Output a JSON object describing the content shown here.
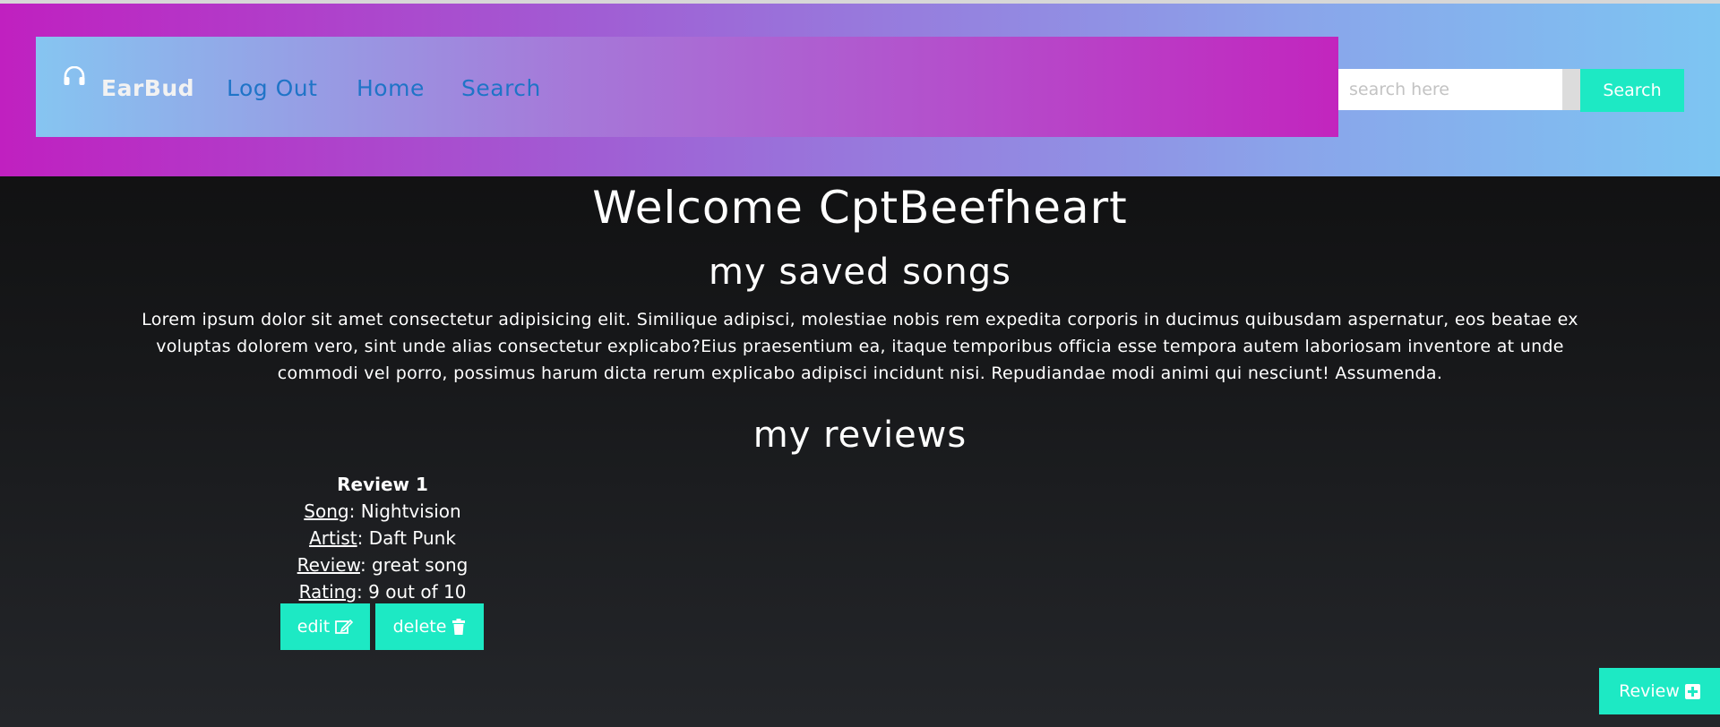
{
  "nav": {
    "brand": "EarBud",
    "links": [
      "Log Out",
      "Home",
      "Search"
    ],
    "brand_icon": "headphones-icon"
  },
  "search": {
    "placeholder": "search here",
    "value": "",
    "button_label": "Search"
  },
  "main": {
    "welcome": "Welcome CptBeefheart",
    "saved_title": "my saved songs",
    "saved_text": "Lorem ipsum dolor sit amet consectetur adipisicing elit. Similique adipisci, molestiae nobis rem expedita corporis in ducimus quibusdam aspernatur, eos beatae ex voluptas dolorem vero, sint unde alias consectetur explicabo?Eius praesentium ea, itaque temporibus officia esse tempora autem laboriosam inventore at unde commodi vel porro, possimus harum dicta rerum explicabo adipisci incidunt nisi. Repudiandae modi animi qui nesciunt! Assumenda.",
    "reviews_title": "my reviews"
  },
  "reviews": [
    {
      "heading": "Review 1",
      "song_label": "Song",
      "song": "Nightvision",
      "artist_label": "Artist",
      "artist": "Daft Punk",
      "review_label": "Review",
      "review": "great song",
      "rating_label": "Rating",
      "rating": "9 out of 10",
      "edit_label": "edit",
      "delete_label": "delete"
    }
  ],
  "fab": {
    "label": "Review"
  },
  "colors": {
    "accent": "#1de9c4",
    "nav_link": "#1f74c7",
    "header_gradient": [
      "#c020c0",
      "#7dc5f2"
    ]
  }
}
